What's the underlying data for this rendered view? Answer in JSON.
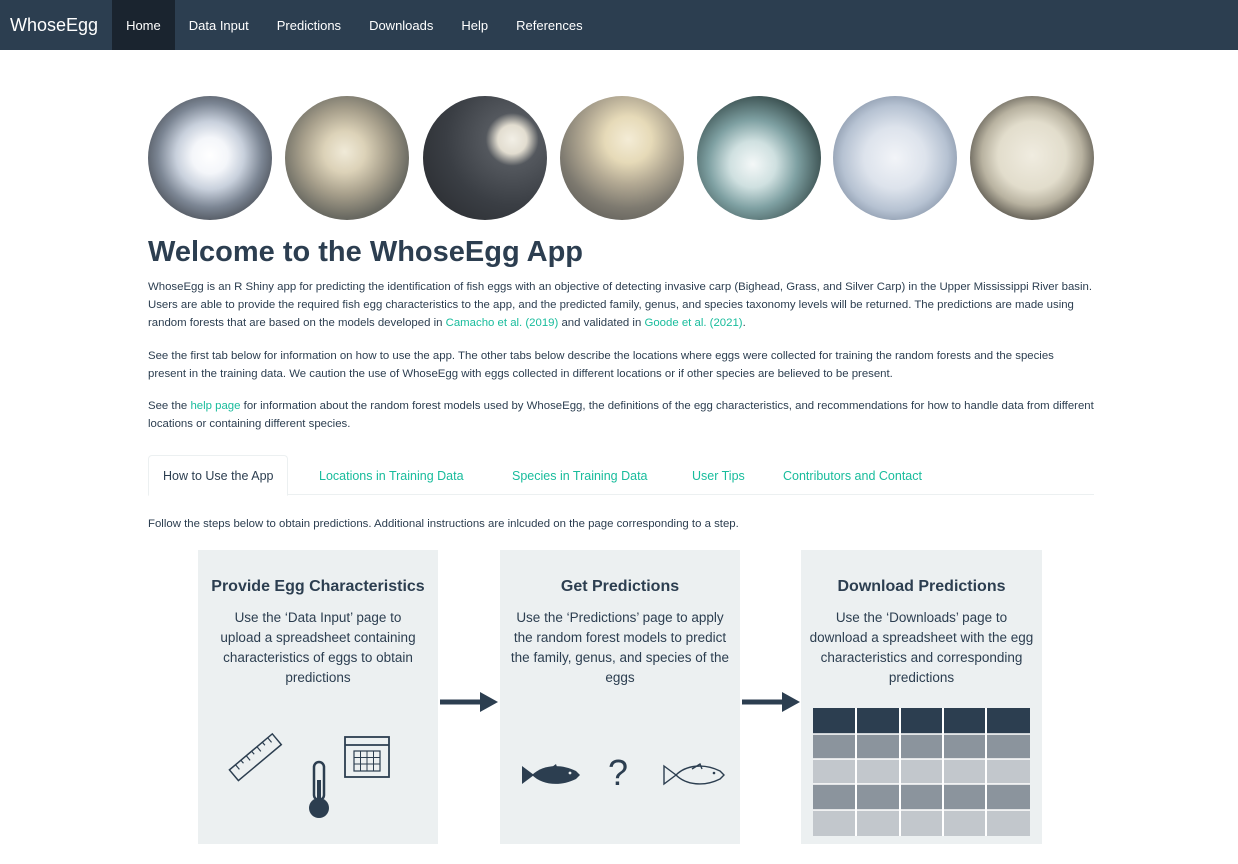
{
  "navbar": {
    "brand": "WhoseEgg",
    "items": [
      {
        "label": "Home",
        "active": true
      },
      {
        "label": "Data Input",
        "active": false
      },
      {
        "label": "Predictions",
        "active": false
      },
      {
        "label": "Downloads",
        "active": false
      },
      {
        "label": "Help",
        "active": false
      },
      {
        "label": "References",
        "active": false
      }
    ]
  },
  "page": {
    "title": "Welcome to the WhoseEgg App",
    "p1_a": "WhoseEgg is an R Shiny app for predicting the identification of fish eggs with an objective of detecting invasive carp (Bighead, Grass, and Silver Carp) in the Upper Mississippi River basin. Users are able to provide the required fish egg characteristics to the app, and the predicted family, genus, and species taxonomy levels will be returned. The predictions are made using random forests that are based on the models developed in ",
    "p1_link1": "Camacho et al. (2019)",
    "p1_b": " and validated in ",
    "p1_link2": "Goode et al. (2021)",
    "p1_c": ".",
    "p2": "See the first tab below for information on how to use the app. The other tabs below describe the locations where eggs were collected for training the random forests and the species present in the training data. We caution the use of WhoseEgg with eggs collected in different locations or if other species are believed to be present.",
    "p3_a": "See the ",
    "p3_link": "help page",
    "p3_b": " for information about the random forest models used by WhoseEgg, the definitions of the egg characteristics, and recommendations for how to handle data from different locations or containing different species."
  },
  "tabs": [
    {
      "label": "How to Use the App",
      "active": true
    },
    {
      "label": "Locations in Training Data",
      "active": false
    },
    {
      "label": "Species in Training Data",
      "active": false
    },
    {
      "label": "User Tips",
      "active": false
    },
    {
      "label": "Contributors and Contact",
      "active": false
    }
  ],
  "instructions": "Follow the steps below to obtain predictions. Additional instructions are inlcuded on the page corresponding to a step.",
  "steps": [
    {
      "title": "Provide Egg Characteristics",
      "description": "Use the ‘Data Input’ page to upload a spreadsheet containing characteristics of eggs to obtain predictions",
      "icons": [
        "ruler-icon",
        "thermometer-icon",
        "calendar-icon"
      ]
    },
    {
      "title": "Get Predictions",
      "description": "Use the ‘Predictions’ page to apply the random forest models to predict the family, genus, and species of the eggs",
      "icons": [
        "fish-filled-icon",
        "question-mark-icon",
        "fish-outline-icon"
      ]
    },
    {
      "title": "Download Predictions",
      "description": "Use the ‘Downloads’ page to download a spreadsheet with the egg characteristics and corresponding predictions",
      "icons": [
        "spreadsheet-icon"
      ]
    }
  ],
  "question_glyph": "?",
  "colors": {
    "navbar": "#2c3e50",
    "navbar_active": "#1a242f",
    "link": "#18bc9c",
    "step_background": "#ecf0f1",
    "text": "#2c3e50"
  }
}
